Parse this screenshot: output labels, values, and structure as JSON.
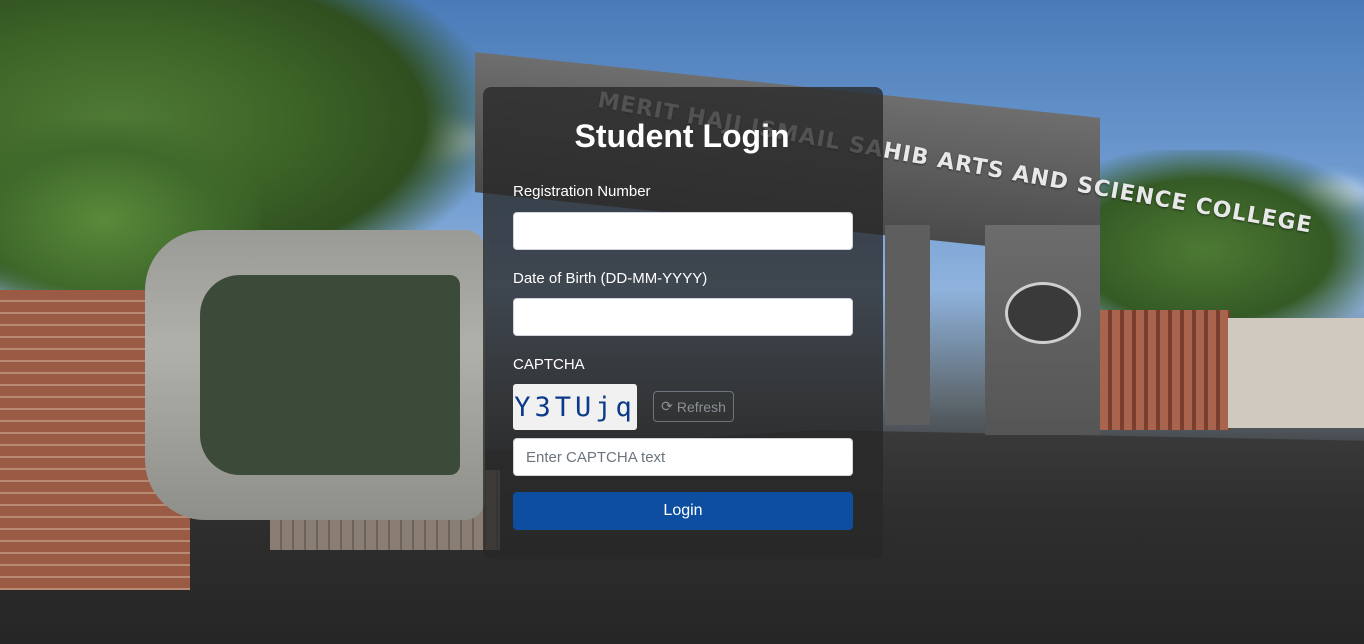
{
  "page": {
    "title": "Student Login",
    "background_sign": "MERIT HAJI ISMAIL SAHIB ARTS AND SCIENCE COLLEGE"
  },
  "form": {
    "registration_label": "Registration Number",
    "registration_value": "",
    "dob_label": "Date of Birth (DD-MM-YYYY)",
    "dob_value": "",
    "captcha_label": "CAPTCHA",
    "captcha_code": "Y3TUjq",
    "refresh_label": "Refresh",
    "refresh_icon": "refresh-icon",
    "captcha_placeholder": "Enter CAPTCHA text",
    "login_label": "Login"
  },
  "colors": {
    "login_button": "#0d4ea1",
    "card_background": "rgba(40,40,40,0.78)",
    "captcha_text": "#0b3a8a"
  }
}
